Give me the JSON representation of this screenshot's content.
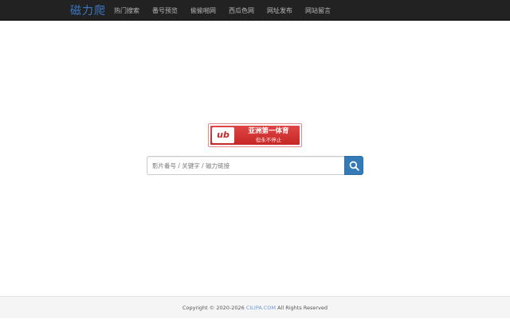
{
  "header": {
    "brand": "磁力爬",
    "nav": [
      {
        "label": "热门搜索"
      },
      {
        "label": "番号预览"
      },
      {
        "label": "偷偷啪网"
      },
      {
        "label": "西瓜色网"
      },
      {
        "label": "网址发布"
      },
      {
        "label": "网站留言"
      }
    ]
  },
  "banner": {
    "logo_text": "ub",
    "title": "亚洲第一体育",
    "subtitle": "但永不停止"
  },
  "search": {
    "placeholder": "影片番号 / 关键字 / 磁力链接",
    "value": "",
    "button_icon": "search-icon"
  },
  "footer": {
    "prefix": "Copyright © 2020-2026 ",
    "site": "CILIPA.COM",
    "suffix": " All Rights Reserved"
  },
  "colors": {
    "navbar": "#222222",
    "brand": "#3a78c3",
    "primary_button": "#337ab7",
    "banner_red": "#c62626"
  }
}
